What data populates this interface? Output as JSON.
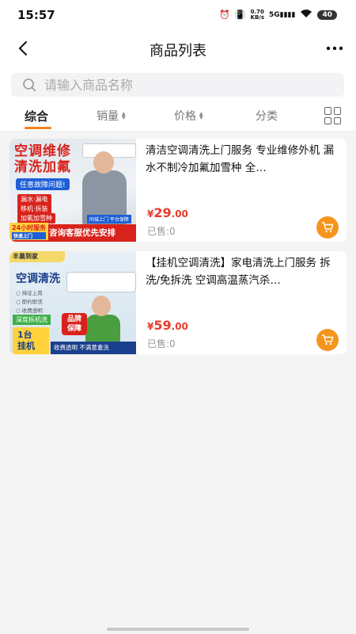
{
  "status_bar": {
    "time": "15:57",
    "net_speed_value": "0.70",
    "net_speed_unit": "KB/s",
    "signal_label": "5G",
    "battery": "40"
  },
  "header": {
    "title": "商品列表"
  },
  "search": {
    "placeholder": "请输入商品名称"
  },
  "tabs": [
    {
      "label": "综合",
      "active": true
    },
    {
      "label": "销量"
    },
    {
      "label": "价格"
    },
    {
      "label": "分类"
    }
  ],
  "products": [
    {
      "title": "清洁空调清洗上门服务 专业维修外机 漏水不制冷加氟加雪种 全…",
      "price_currency": "¥",
      "price_int": "29",
      "price_dec": ".00",
      "sold": "已售:0",
      "image": {
        "headline_1": "空调维修",
        "headline_2": "清洗加氟",
        "badge": "任意故障问题!",
        "tags": [
          "漏水·漏电",
          "移机·拆装",
          "加氟加雪种"
        ],
        "hours": "24小时服务",
        "fast": "快速上门",
        "guarantee": "同城上门 平台保障",
        "banner": "咨询客服优先安排"
      }
    },
    {
      "title": "【挂机空调清洗】家电清洗上门服务 拆洗/免拆洗 空调高温蒸汽杀…",
      "price_currency": "¥",
      "price_int": "59",
      "price_dec": ".00",
      "sold": "已售:0",
      "image": {
        "brand": "丰巢到家",
        "headline": "空调清洗",
        "list": [
          "○ 持证上岗",
          "○ 即约即洗",
          "○ 收费透明"
        ],
        "deep": "深度拆机洗",
        "box_1": "1台",
        "box_2": "挂机",
        "badge_1": "品牌",
        "badge_2": "保障",
        "bottom": "收费透明 不满意重洗"
      }
    }
  ],
  "colors": {
    "accent": "#f5821f",
    "price": "#ea3a2a",
    "cart": "#f7941d"
  }
}
